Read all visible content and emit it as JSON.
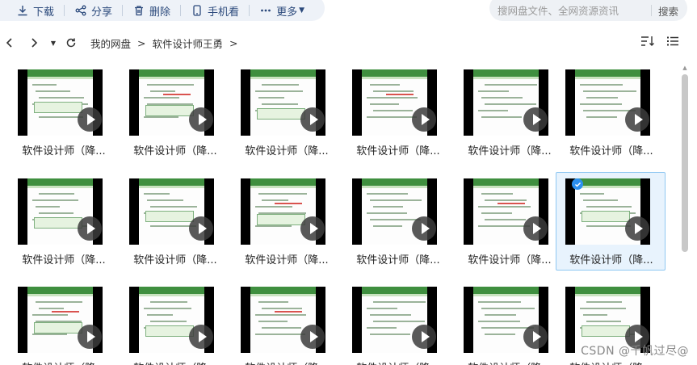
{
  "toolbar": {
    "download": "下载",
    "share": "分享",
    "delete": "删除",
    "phone_view": "手机看",
    "more": "更多"
  },
  "search": {
    "placeholder": "搜网盘文件、全网资源资讯",
    "button": "搜索"
  },
  "breadcrumb": {
    "root": "我的网盘",
    "sep1": ">",
    "folder": "软件设计师王勇",
    "sep2": ">"
  },
  "files": [
    {
      "name": "软件设计师（降..."
    },
    {
      "name": "软件设计师（降..."
    },
    {
      "name": "软件设计师（降..."
    },
    {
      "name": "软件设计师（降..."
    },
    {
      "name": "软件设计师（降..."
    },
    {
      "name": "软件设计师（降..."
    },
    {
      "name": "软件设计师（降..."
    },
    {
      "name": "软件设计师（降..."
    },
    {
      "name": "软件设计师（降..."
    },
    {
      "name": "软件设计师（降..."
    },
    {
      "name": "软件设计师（降..."
    },
    {
      "name": "软件设计师（降..."
    },
    {
      "name": "软件设计师（降..."
    },
    {
      "name": "软件设计师（降..."
    },
    {
      "name": "软件设计师（降..."
    },
    {
      "name": "软件设计师（降..."
    },
    {
      "name": "软件设计师（降..."
    },
    {
      "name": "软件设计师（降..."
    }
  ],
  "selected_index": 11,
  "watermark": "CSDN @千帆过尽@",
  "colors": {
    "accent": "#2b8ff0",
    "toolbar_text": "#2c4a7c",
    "slide_header": "#3f8f3f"
  }
}
